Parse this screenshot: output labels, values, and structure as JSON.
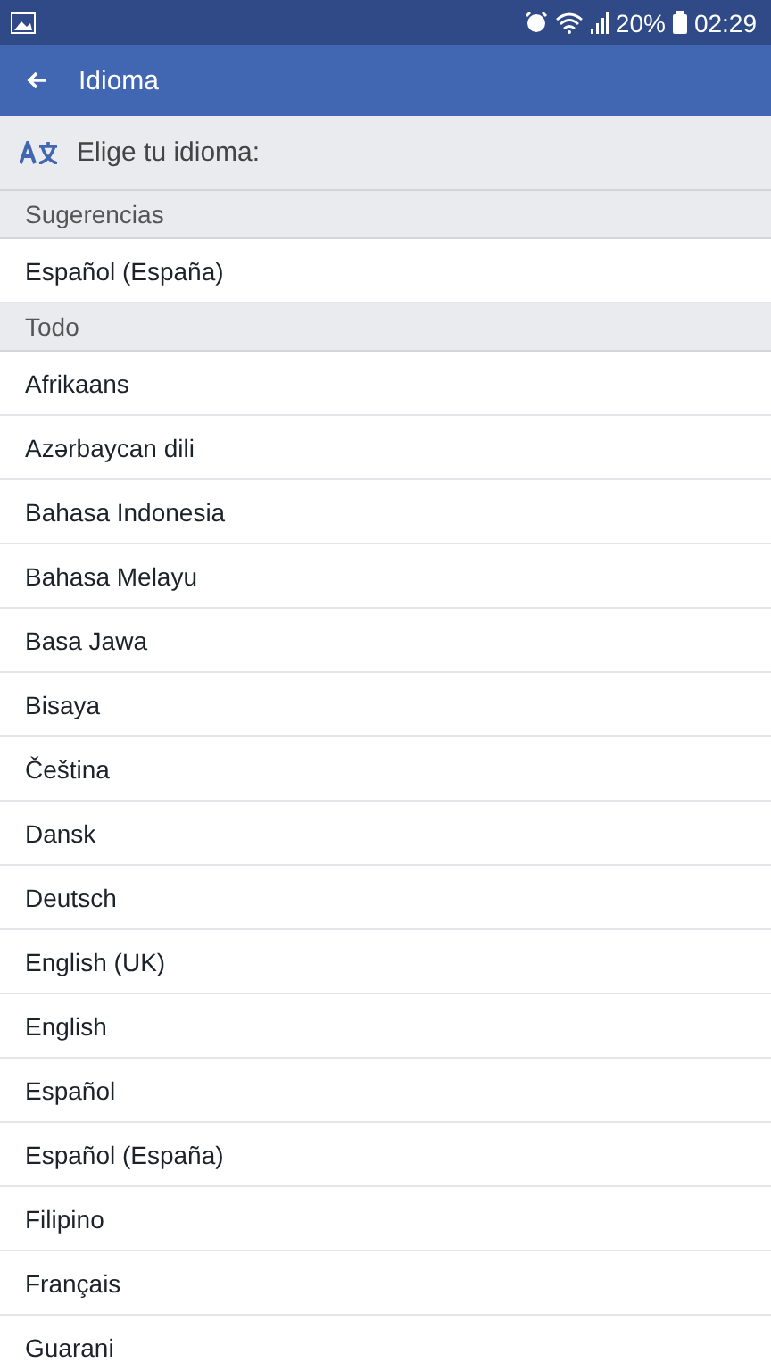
{
  "status_bar": {
    "battery": "20%",
    "time": "02:29"
  },
  "app_bar": {
    "title": "Idioma"
  },
  "prompt": "Elige tu idioma:",
  "sections": [
    {
      "title": "Sugerencias",
      "items": [
        "Español (España)"
      ]
    },
    {
      "title": "Todo",
      "items": [
        "Afrikaans",
        "Azərbaycan dili",
        "Bahasa Indonesia",
        "Bahasa Melayu",
        "Basa Jawa",
        "Bisaya",
        "Čeština",
        "Dansk",
        "Deutsch",
        "English (UK)",
        "English",
        "Español",
        "Español (España)",
        "Filipino",
        "Français",
        "Guarani"
      ]
    }
  ]
}
